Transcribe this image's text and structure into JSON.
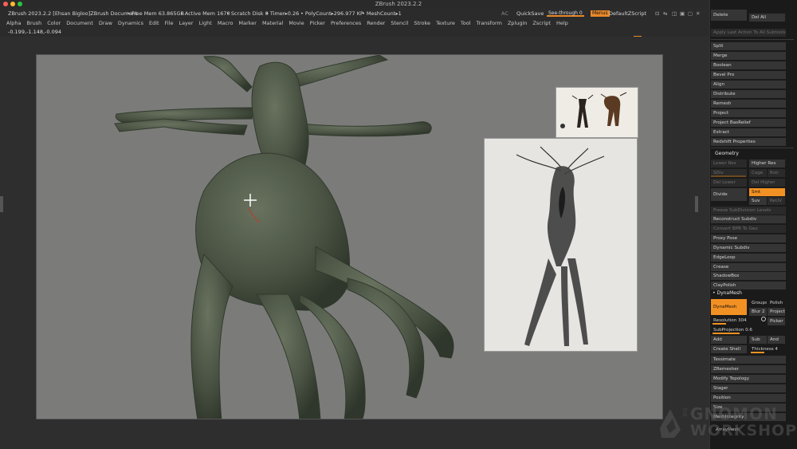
{
  "window": {
    "title": "ZBrush 2023.2.2",
    "traffic_lights": [
      "#ff5f57",
      "#febc2e",
      "#28c840"
    ]
  },
  "infobar": {
    "document": "ZBrush 2023.2.2 [Ehsan Bigloo]ZBrush Document",
    "free_mem": "• Free Mem 63.865GB",
    "active_mem": "• Active Mem 1670",
    "scratch_disk": "• Scratch Disk 0",
    "timer": "• Timer▸0.26",
    "polycount": "• PolyCount▸296.977 KP",
    "meshcount": "• MeshCount▸1",
    "ac": "AC",
    "quicksave": "QuickSave",
    "see_through": "See-through  0",
    "menus": "Menus",
    "default_zscript": "DefaultZScript",
    "accent": "#e8882a"
  },
  "menubar": [
    "Alpha",
    "Brush",
    "Color",
    "Document",
    "Draw",
    "Dynamics",
    "Edit",
    "File",
    "Layer",
    "Light",
    "Macro",
    "Marker",
    "Material",
    "Movie",
    "Picker",
    "Preferences",
    "Render",
    "Stencil",
    "Stroke",
    "Texture",
    "Tool",
    "Transform",
    "Zplugin",
    "Zscript",
    "Help"
  ],
  "coords": "-0.199,-1.148,-0.094",
  "palette": {
    "top": {
      "delete": "Delete",
      "del_all": "Del All",
      "apply_last": "Apply Last Action To All Subtools",
      "items": [
        "Split",
        "Merge",
        "Boolean",
        "Bevel Pro",
        "Align",
        "Distribute",
        "Remesh",
        "Project",
        "Project BasRelief",
        "Extract",
        "Redshift Properties"
      ]
    },
    "geometry": {
      "title": "Geometry",
      "lower_res": "Lower Res",
      "higher_res": "Higher Res",
      "sdiv": "SDiv",
      "cage": "Cage",
      "rstr": "Rstr",
      "del_lower": "Del Lower",
      "del_higher": "Del Higher",
      "divide": "Divide",
      "smt": "Smt",
      "suv": "Suv",
      "reuv": "ReUV",
      "freeze": "Freeze SubDivision Levels",
      "reconstruct": "Reconstruct Subdiv",
      "convert_bpr": "Convert BPR To Geo",
      "items": [
        "Proxy Pose",
        "Dynamic Subdiv",
        "EdgeLoop",
        "Crease",
        "ShadowBox",
        "ClayPolish"
      ]
    },
    "dynamesh": {
      "title": "DynaMesh",
      "button": "DynaMesh",
      "groups": "Groups",
      "polish": "Polish",
      "blur": "Blur 2",
      "project": "Project",
      "resolution": "Resolution 304",
      "resolution_value": 0.3,
      "picker": "Picker",
      "subprojection": "SubProjection 0.6",
      "subprojection_value": 0.6,
      "add": "Add",
      "sub": "Sub",
      "and": "And",
      "create_shell": "Create Shell",
      "thickness": "Thickness 4",
      "thickness_value": 0.4
    },
    "bottom": [
      "Tessimate",
      "ZRemesher",
      "Modify Topology",
      "Stager",
      "Position",
      "Size",
      "MeshIntegrity",
      "ArrayMesh"
    ],
    "accent": "#f29123"
  },
  "watermark": {
    "the": "THE",
    "line1": "GNOMON",
    "line2": "WORKSHOP"
  },
  "viewport": {
    "background": "#7b7c7a",
    "model_color": "#4d5646"
  }
}
